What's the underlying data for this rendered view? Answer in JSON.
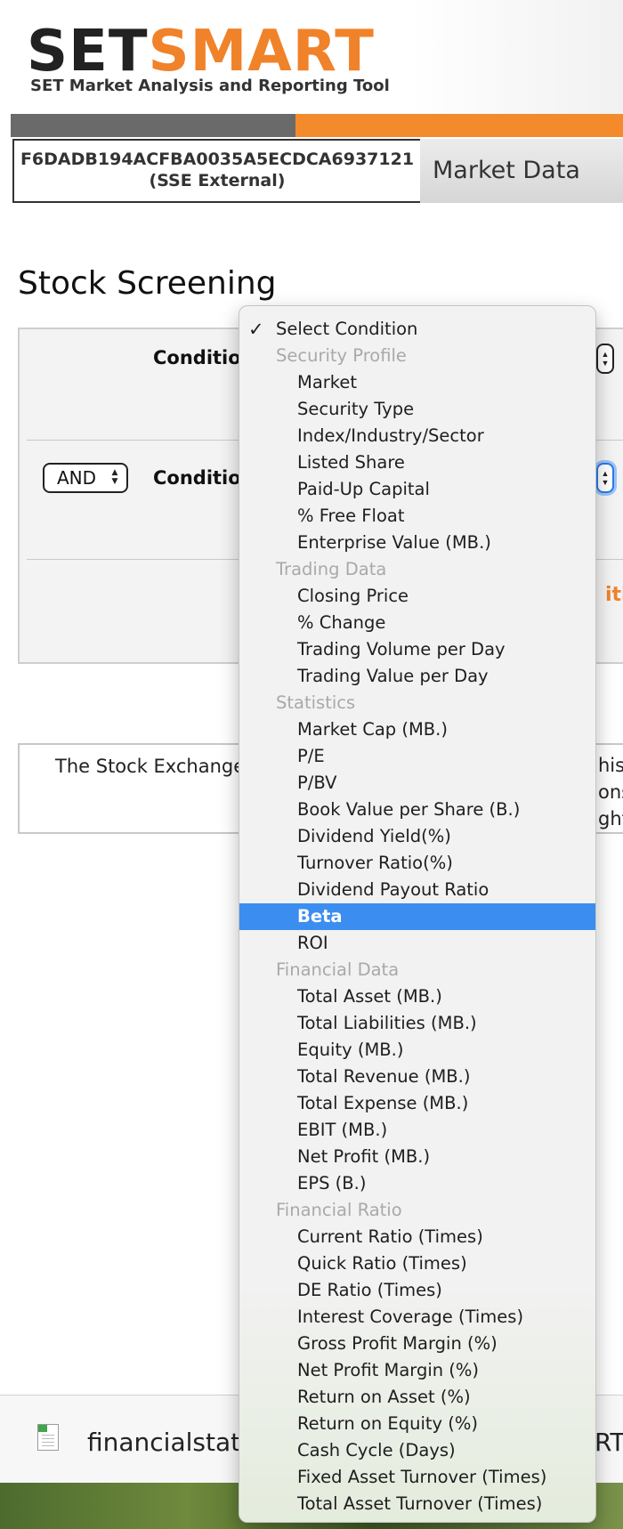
{
  "header": {
    "logo_set": "SET",
    "logo_smart": "SMART",
    "tagline": "SET Market Analysis and Reporting Tool",
    "session_id": "F6DADB194ACFBA0035A5ECDCA6937121",
    "session_type": "(SSE External)",
    "market_tab": "Market Data"
  },
  "page": {
    "title": "Stock Screening"
  },
  "criteria": {
    "condition_label_1": "Condition",
    "condition_label_2": "Condition",
    "operator": "AND",
    "add_condition_fragment": "itic"
  },
  "disclaimer": {
    "text_left": "The Stock Exchange o",
    "right_1": "his",
    "right_2": "onsi",
    "right_3": "ght"
  },
  "download": {
    "file_name": "financialstate",
    "right_fragment": "RT"
  },
  "dropdown": {
    "selected_placeholder": "Select Condition",
    "highlighted": "Beta",
    "groups": [
      {
        "label": "Security Profile",
        "items": [
          "Market",
          "Security Type",
          "Index/Industry/Sector",
          "Listed Share",
          "Paid-Up Capital",
          "% Free Float",
          "Enterprise Value (MB.)"
        ]
      },
      {
        "label": "Trading Data",
        "items": [
          "Closing Price",
          "% Change",
          "Trading Volume per Day",
          "Trading Value per Day"
        ]
      },
      {
        "label": "Statistics",
        "items": [
          "Market Cap (MB.)",
          "P/E",
          "P/BV",
          "Book Value per Share (B.)",
          "Dividend Yield(%)",
          "Turnover Ratio(%)",
          "Dividend Payout Ratio",
          "Beta",
          "ROI"
        ]
      },
      {
        "label": "Financial Data",
        "items": [
          "Total Asset (MB.)",
          "Total Liabilities (MB.)",
          "Equity (MB.)",
          "Total Revenue (MB.)",
          "Total Expense (MB.)",
          "EBIT (MB.)",
          "Net Profit (MB.)",
          "EPS (B.)"
        ]
      },
      {
        "label": "Financial Ratio",
        "items": [
          "Current Ratio (Times)",
          "Quick Ratio (Times)",
          "DE Ratio (Times)",
          "Interest Coverage (Times)",
          "Gross Profit Margin (%)",
          "Net Profit Margin (%)",
          "Return on Asset (%)",
          "Return on Equity (%)",
          "Cash Cycle (Days)",
          "Fixed Asset Turnover (Times)",
          "Total Asset Turnover (Times)"
        ]
      }
    ]
  },
  "colors": {
    "brand_orange": "#f0822a",
    "highlight_blue": "#3b8ef0"
  }
}
